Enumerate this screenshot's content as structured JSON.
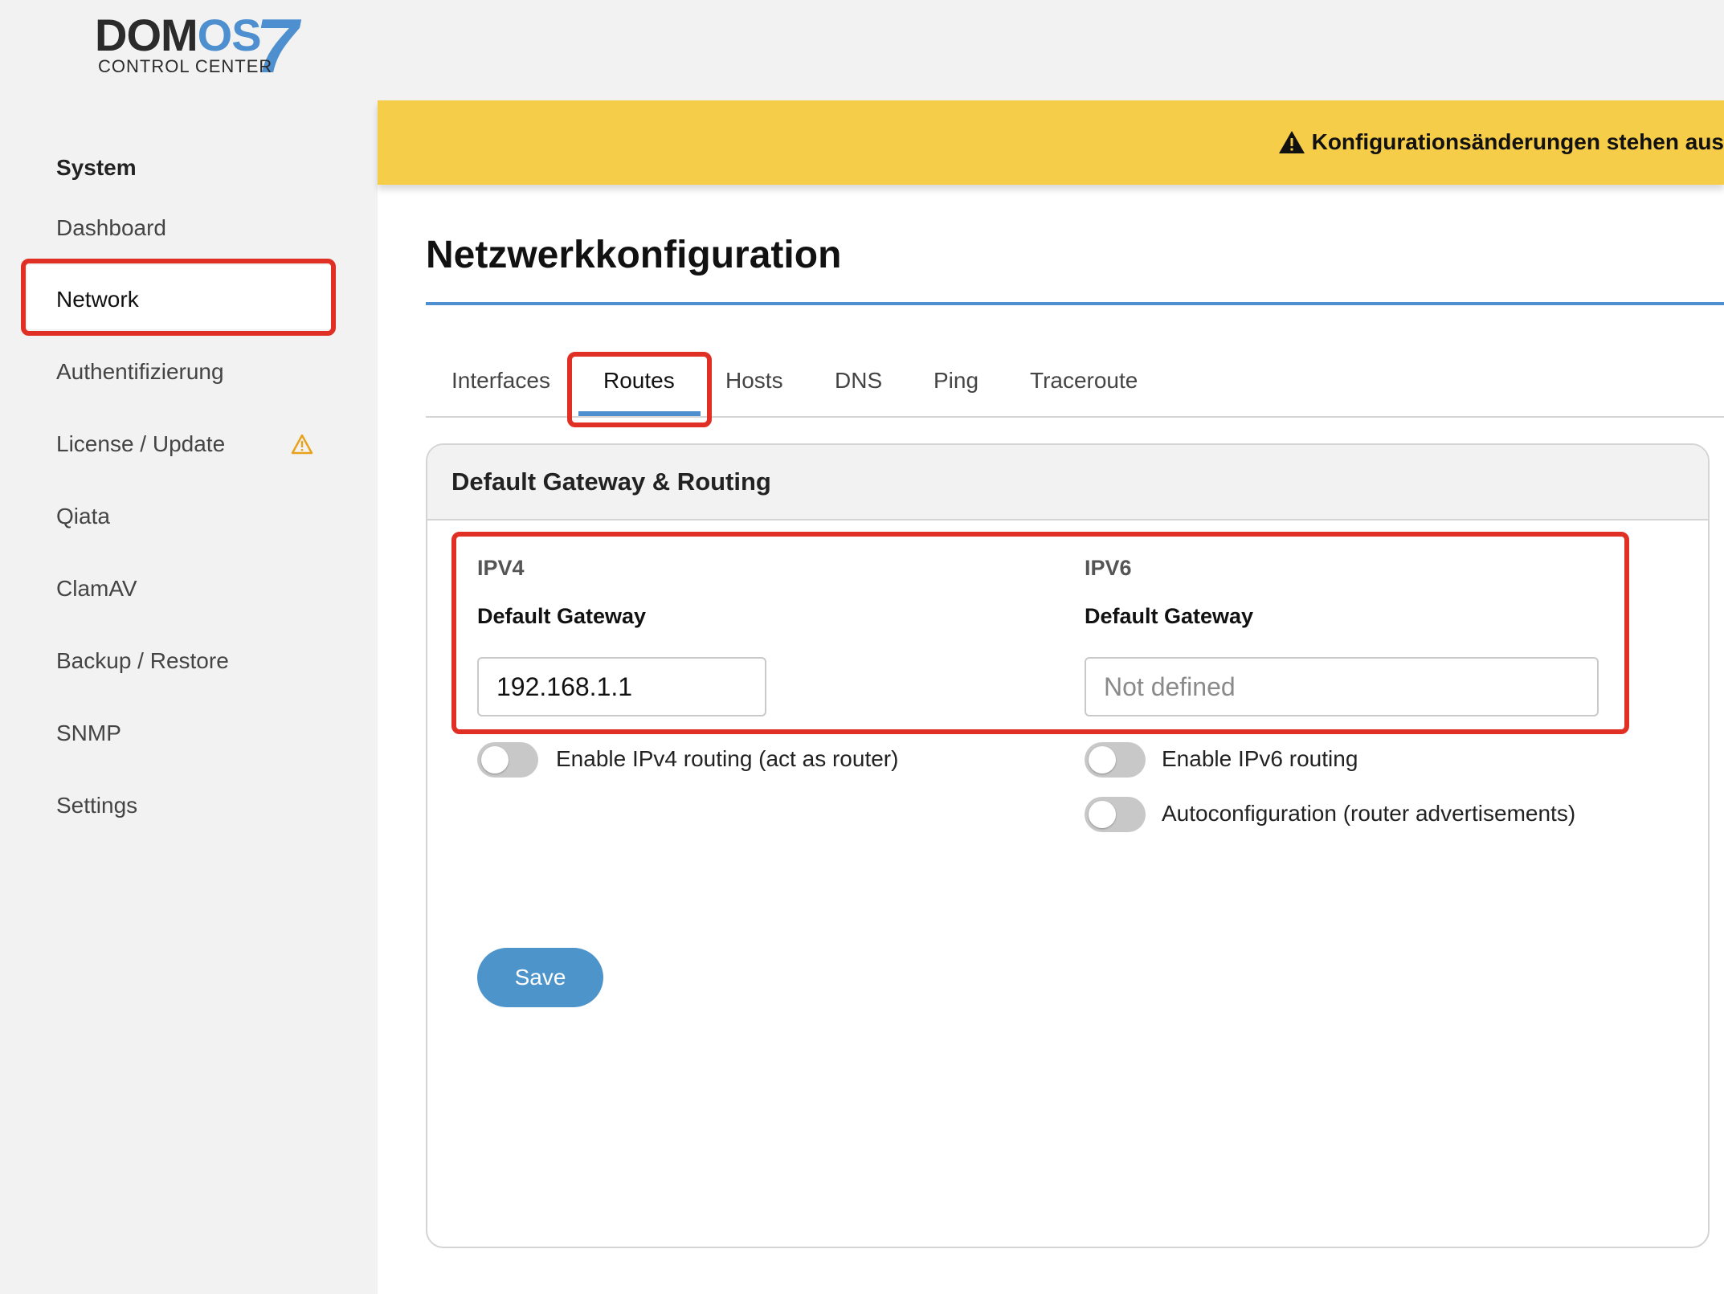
{
  "app": {
    "logo_main_dark": "DOM",
    "logo_main_blue": "OS",
    "logo_version": "7",
    "logo_subtitle": "CONTROL CENTER"
  },
  "sidebar": {
    "heading": "System",
    "items": [
      {
        "label": "Dashboard"
      },
      {
        "label": "Network",
        "active": true
      },
      {
        "label": "Authentifizierung"
      },
      {
        "label": "License / Update",
        "warning_icon": "warning-icon"
      },
      {
        "label": "Qiata"
      },
      {
        "label": "ClamAV"
      },
      {
        "label": "Backup / Restore"
      },
      {
        "label": "SNMP"
      },
      {
        "label": "Settings"
      }
    ]
  },
  "banner": {
    "icon": "warning-icon",
    "text": "Konfigurationsänderungen stehen aus"
  },
  "page": {
    "title": "Netzwerkkonfiguration"
  },
  "tabs": [
    {
      "label": "Interfaces"
    },
    {
      "label": "Routes",
      "active": true
    },
    {
      "label": "Hosts"
    },
    {
      "label": "DNS"
    },
    {
      "label": "Ping"
    },
    {
      "label": "Traceroute"
    }
  ],
  "card": {
    "title": "Default Gateway & Routing",
    "ipv4": {
      "heading": "IPV4",
      "gateway_label": "Default Gateway",
      "gateway_value": "192.168.1.1",
      "routing_toggle_label": "Enable IPv4 routing (act as router)",
      "routing_enabled": false
    },
    "ipv6": {
      "heading": "IPV6",
      "gateway_label": "Default Gateway",
      "gateway_placeholder": "Not defined",
      "routing_toggle_label": "Enable IPv6 routing",
      "routing_enabled": false,
      "autoconf_toggle_label": "Autoconfiguration (router advertisements)",
      "autoconf_enabled": false
    },
    "save_label": "Save"
  },
  "colors": {
    "accent": "#4d8fcf",
    "banner": "#f6cd49",
    "highlight": "#e03025",
    "warning_icon": "#e8a21c"
  }
}
